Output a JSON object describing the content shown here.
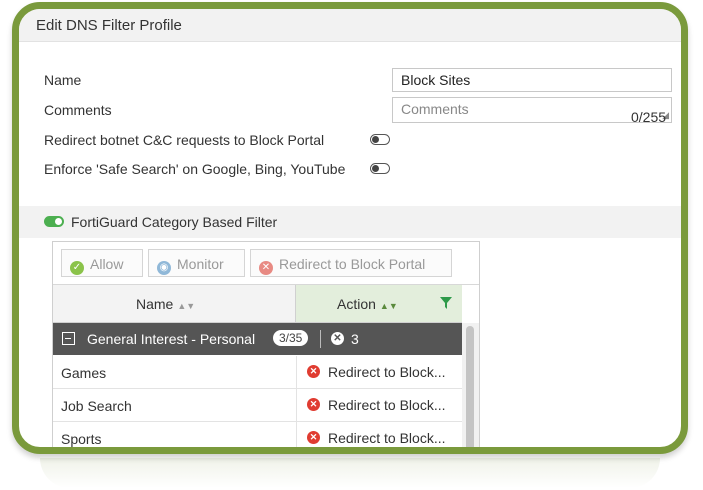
{
  "window": {
    "title": "Edit DNS Filter Profile"
  },
  "form": {
    "name_label": "Name",
    "name_value": "Block Sites",
    "comments_label": "Comments",
    "comments_placeholder": "Comments",
    "comments_counter": "0/255",
    "redirect_botnet_label": "Redirect botnet C&C requests to Block Portal",
    "redirect_botnet_enabled": false,
    "safe_search_label": "Enforce 'Safe Search' on Google, Bing, YouTube",
    "safe_search_enabled": false
  },
  "fortiguard": {
    "label": "FortiGuard Category Based Filter",
    "enabled": true,
    "buttons": {
      "allow": "Allow",
      "monitor": "Monitor",
      "redirect": "Redirect to Block Portal"
    },
    "columns": {
      "name": "Name",
      "action": "Action"
    },
    "group": {
      "label": "General Interest - Personal",
      "count_badge": "3/35",
      "blocked_count": "3"
    },
    "rows": [
      {
        "name": "Games",
        "action": "Redirect to Block..."
      },
      {
        "name": "Job Search",
        "action": "Redirect to Block..."
      },
      {
        "name": "Sports",
        "action": "Redirect to Block..."
      }
    ]
  },
  "colors": {
    "frame_border": "#7a9a3c",
    "toggle_on": "#4caf50",
    "group_bg": "#555555",
    "redirect_icon": "#e03c31",
    "allow_icon": "#8bc34a",
    "monitor_icon": "#90b8d8"
  }
}
